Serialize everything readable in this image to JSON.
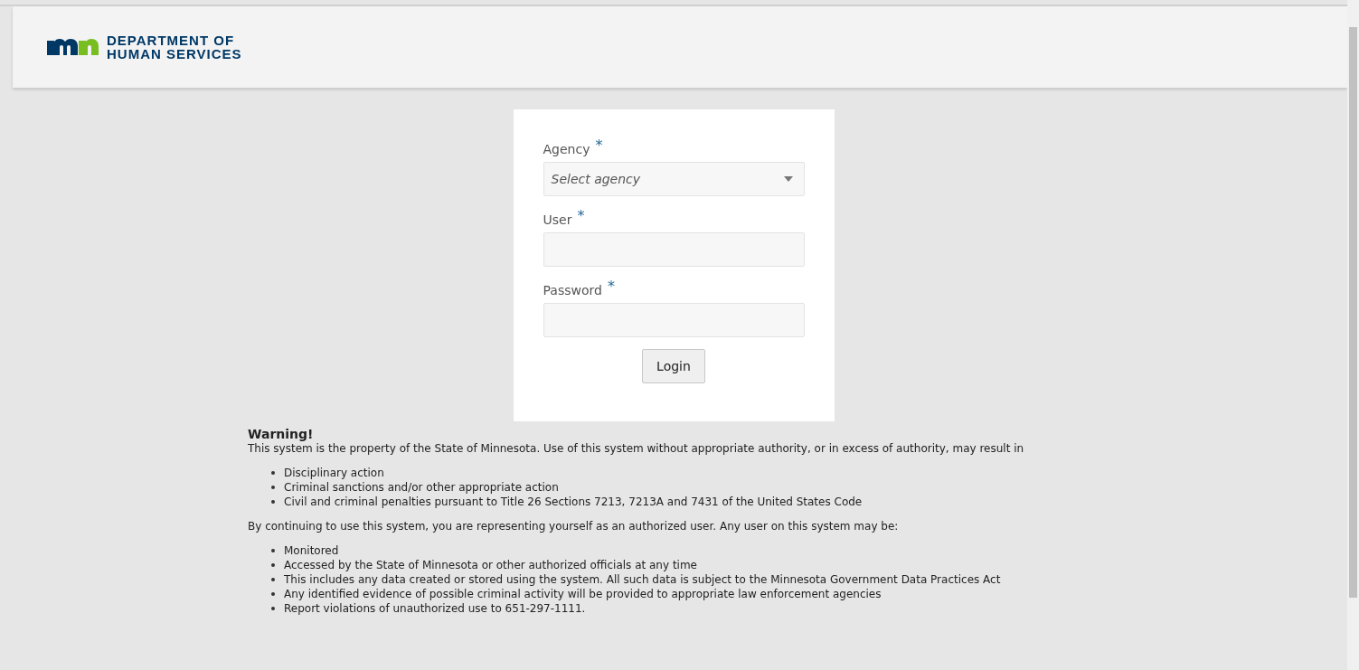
{
  "header": {
    "org_name_line_1": "DEPARTMENT OF",
    "org_name_line_2": "HUMAN SERVICES"
  },
  "login_form": {
    "fields": [
      {
        "kind": "select",
        "label": "Agency",
        "required": true,
        "placeholder": "Select agency"
      },
      {
        "kind": "text",
        "label": "User",
        "required": true
      },
      {
        "kind": "password",
        "label": "Password",
        "required": true
      }
    ],
    "required_mark": "*",
    "submit": "Login"
  },
  "warning": {
    "title": "Warning!",
    "intro": "This system is the property of the State of Minnesota. Use of this system without appropriate authority, or in excess of authority, may result in",
    "consequences": [
      "Disciplinary action",
      "Criminal sanctions and/or other appropriate action",
      "Civil and criminal penalties pursuant to Title 26 Sections 7213, 7213A and 7431 of the United States Code"
    ],
    "notice": "By continuing to use this system, you are representing yourself as an authorized user. Any user on this system may be:",
    "conditions": [
      "Monitored",
      "Accessed by the State of Minnesota or other authorized officials at any time",
      "This includes any data created or stored using the system. All such data is subject to the Minnesota Government Data Practices Act",
      "Any identified evidence of possible criminal activity will be provided to appropriate law enforcement agencies",
      "Report violations of unauthorized use to 651-297-1111."
    ]
  }
}
